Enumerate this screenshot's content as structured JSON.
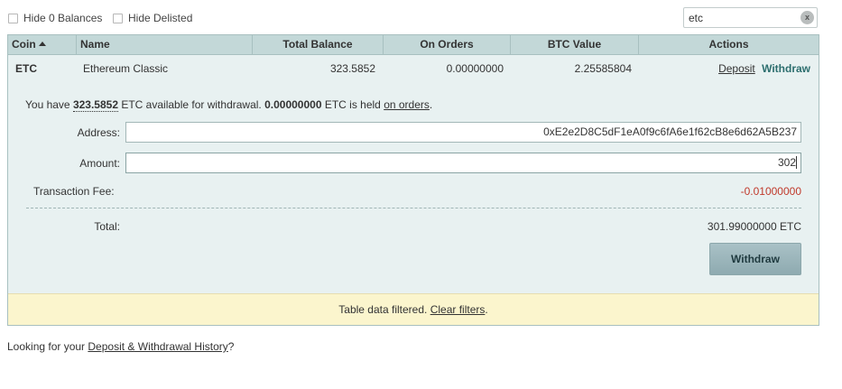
{
  "filters": {
    "hide_zero_label": "Hide 0 Balances",
    "hide_delisted_label": "Hide Delisted"
  },
  "search": {
    "value": "etc",
    "clear_label": "x"
  },
  "table": {
    "headers": {
      "coin": "Coin",
      "name": "Name",
      "total": "Total Balance",
      "orders": "On Orders",
      "btc": "BTC Value",
      "actions": "Actions"
    },
    "row": {
      "coin": "ETC",
      "name": "Ethereum Classic",
      "total": "323.5852",
      "orders": "0.00000000",
      "btc": "2.25585804",
      "deposit": "Deposit",
      "withdraw": "Withdraw"
    }
  },
  "withdraw": {
    "text_1": "You have ",
    "available_amount": "323.5852",
    "text_2": " ETC available for withdrawal. ",
    "held_amount": "0.00000000",
    "text_3": " ETC is held ",
    "on_orders": "on orders",
    "text_4": ".",
    "address_label": "Address:",
    "address_value": "0xE2e2D8C5dF1eA0f9c6fA6e1f62cB8e6d62A5B237",
    "amount_label": "Amount:",
    "amount_value": "302",
    "fee_label": "Transaction Fee:",
    "fee_value": "-0.01000000",
    "total_label": "Total:",
    "total_value": "301.99000000 ETC",
    "button_label": "Withdraw"
  },
  "filter_notice": {
    "text": "Table data filtered. ",
    "clear_link": "Clear filters",
    "end": "."
  },
  "footer": {
    "text": "Looking for your ",
    "link": "Deposit & Withdrawal History",
    "end": "?"
  },
  "colors": {
    "header_bg": "#c3d8d8",
    "panel_bg": "#e8f1f1",
    "fee_red": "#c0392b",
    "withdraw_link": "#2c6e6e",
    "notice_bg": "#fbf5cd"
  }
}
